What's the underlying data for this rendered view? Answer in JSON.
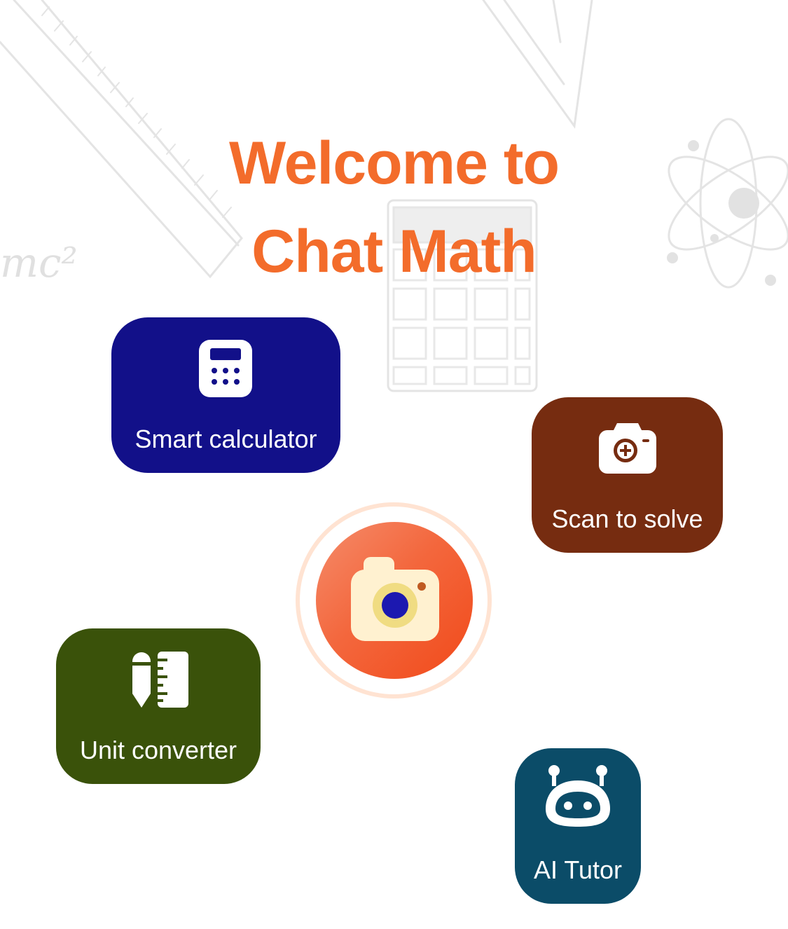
{
  "title": {
    "line1": "Welcome to",
    "line2": "Chat Math"
  },
  "background": {
    "doodle_text": "mc²"
  },
  "features": {
    "calculator": {
      "label": "Smart calculator",
      "icon": "calculator-icon",
      "color": "#121089"
    },
    "scan": {
      "label": "Scan to solve",
      "icon": "camera-plus-icon",
      "color": "#762c10"
    },
    "unit": {
      "label": "Unit converter",
      "icon": "pencil-ruler-icon",
      "color": "#3a520a"
    },
    "ai": {
      "label": "AI Tutor",
      "icon": "robot-icon",
      "color": "#0b4c68"
    }
  },
  "camera_button": {
    "icon": "camera-icon",
    "accent": "#f36c2b"
  },
  "colors": {
    "title": "#f36c2b"
  }
}
